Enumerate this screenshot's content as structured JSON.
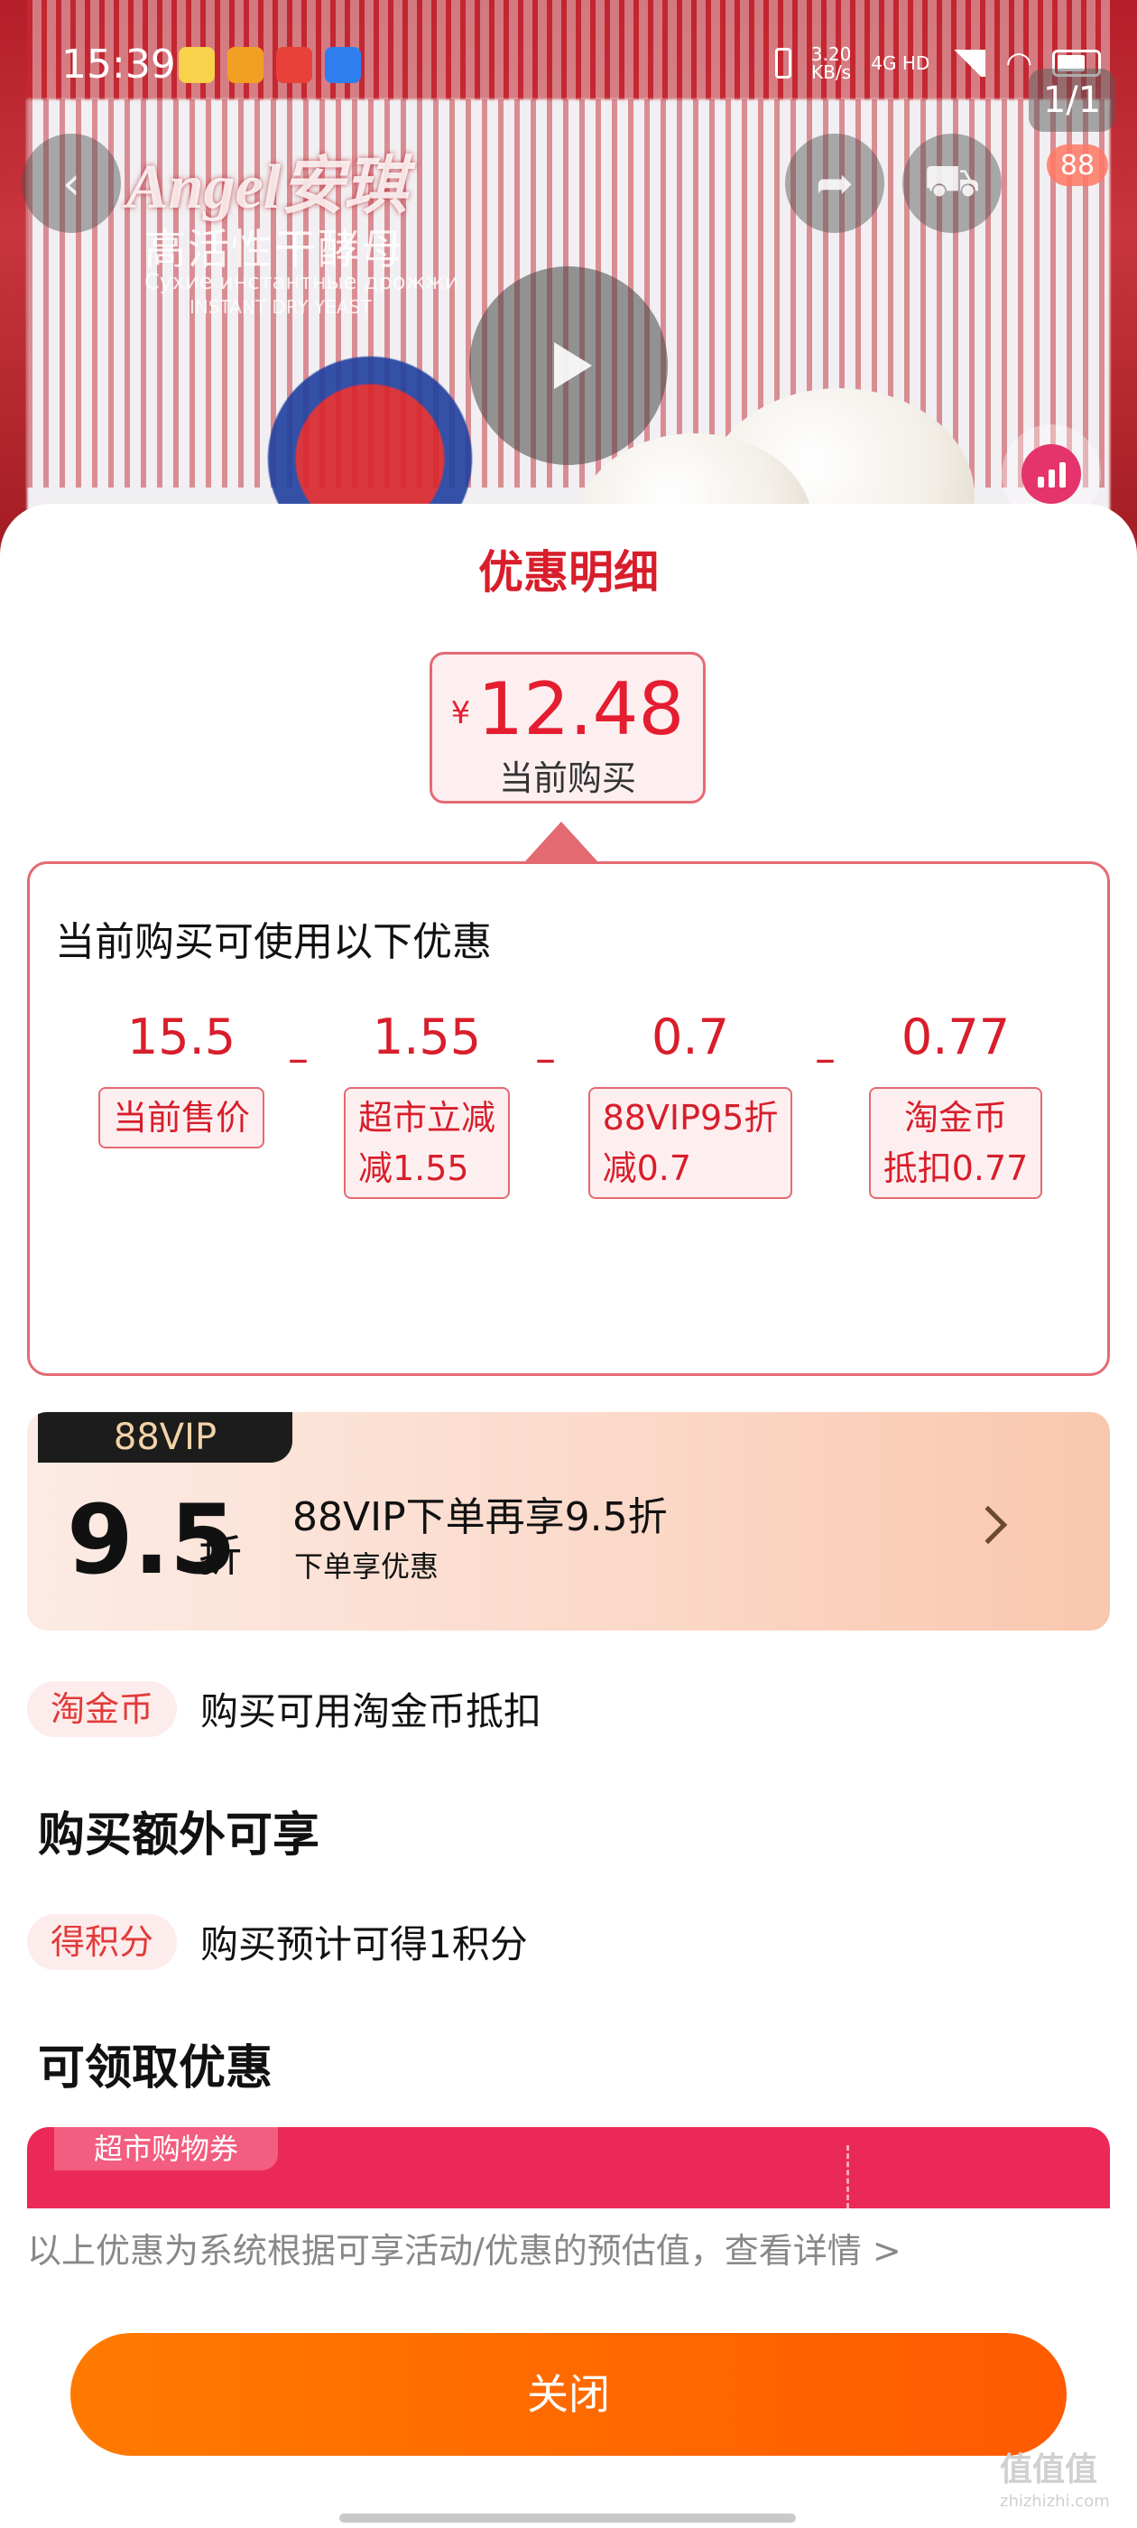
{
  "status_bar": {
    "time": "15:39",
    "net_speed_value": "3.20",
    "net_speed_unit": "KB/s",
    "network_label": "4G HD"
  },
  "background": {
    "brand": "Angel安琪",
    "product_name": "高活性干酵母",
    "product_name_ru": "Сухие инстантные дрожжи",
    "product_name_en": "INSTANT DRY YEAST",
    "page_indicator": "1/1",
    "cart_count": "88"
  },
  "sheet": {
    "title": "优惠明细",
    "price": {
      "currency": "¥",
      "value": "12.48",
      "caption": "当前购买"
    },
    "breakdown": {
      "title": "当前购买可使用以下优惠",
      "items": [
        {
          "value": "15.5",
          "tag": "当前售价",
          "sub": ""
        },
        {
          "value": "1.55",
          "tag": "超市立减",
          "sub": "减1.55"
        },
        {
          "value": "0.7",
          "tag": "88VIP95折",
          "sub": "减0.7"
        },
        {
          "value": "0.77",
          "tag": "淘金币",
          "sub": "抵扣0.77"
        }
      ],
      "operator": "–"
    },
    "vip": {
      "badge": "88VIP",
      "discount": "9.5",
      "discount_unit": "折",
      "title": "88VIP下单再享9.5折",
      "subtitle": "下单享优惠"
    },
    "taojinbi": {
      "pill": "淘金币",
      "text": "购买可用淘金币抵扣"
    },
    "extra": {
      "heading": "购买额外可享",
      "pill": "得积分",
      "text": "购买预计可得1积分"
    },
    "claimable": {
      "heading": "可领取优惠",
      "coupon_tag": "超市购物券"
    },
    "disclaimer": "以上优惠为系统根据可享活动/优惠的预估值，查看详情 >",
    "close_label": "关闭"
  },
  "watermark": {
    "text": "值值值",
    "sub": "zhizhizhi.com"
  },
  "colors": {
    "accent_red": "#d81e2b",
    "close_button": "#ff6a00",
    "coupon": "#ea2957"
  }
}
